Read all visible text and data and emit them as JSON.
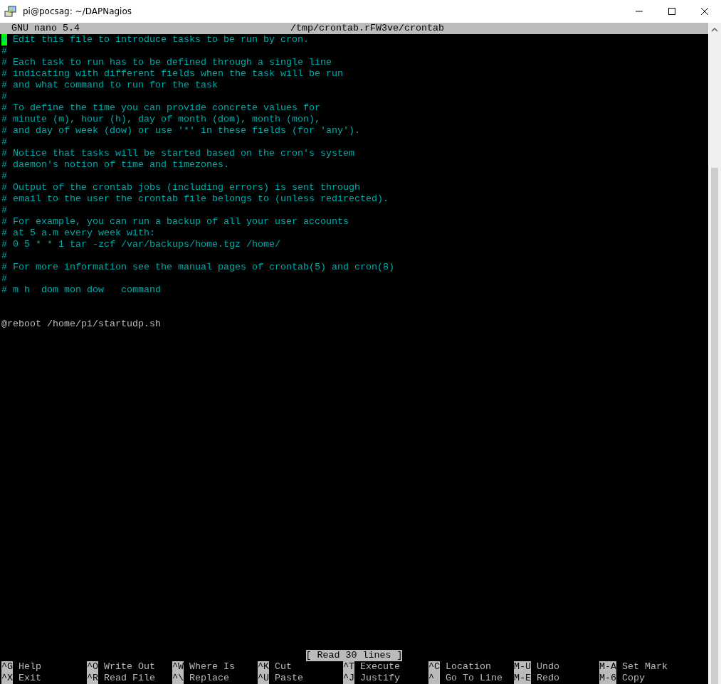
{
  "window": {
    "title": "pi@pocsag: ~/DAPNagios"
  },
  "header": {
    "program": "GNU nano 5.4",
    "file": "/tmp/crontab.rFW3ve/crontab"
  },
  "lines": [
    {
      "kind": "comment",
      "text": "# Edit this file to introduce tasks to be run by cron.",
      "cursor": true
    },
    {
      "kind": "comment",
      "text": "#",
      "cursor": false
    },
    {
      "kind": "comment",
      "text": "# Each task to run has to be defined through a single line",
      "cursor": false
    },
    {
      "kind": "comment",
      "text": "# indicating with different fields when the task will be run",
      "cursor": false
    },
    {
      "kind": "comment",
      "text": "# and what command to run for the task",
      "cursor": false
    },
    {
      "kind": "comment",
      "text": "#",
      "cursor": false
    },
    {
      "kind": "comment",
      "text": "# To define the time you can provide concrete values for",
      "cursor": false
    },
    {
      "kind": "comment",
      "text": "# minute (m), hour (h), day of month (dom), month (mon),",
      "cursor": false
    },
    {
      "kind": "comment",
      "text": "# and day of week (dow) or use '*' in these fields (for 'any').",
      "cursor": false
    },
    {
      "kind": "comment",
      "text": "#",
      "cursor": false
    },
    {
      "kind": "comment",
      "text": "# Notice that tasks will be started based on the cron's system",
      "cursor": false
    },
    {
      "kind": "comment",
      "text": "# daemon's notion of time and timezones.",
      "cursor": false
    },
    {
      "kind": "comment",
      "text": "#",
      "cursor": false
    },
    {
      "kind": "comment",
      "text": "# Output of the crontab jobs (including errors) is sent through",
      "cursor": false
    },
    {
      "kind": "comment",
      "text": "# email to the user the crontab file belongs to (unless redirected).",
      "cursor": false
    },
    {
      "kind": "comment",
      "text": "#",
      "cursor": false
    },
    {
      "kind": "comment",
      "text": "# For example, you can run a backup of all your user accounts",
      "cursor": false
    },
    {
      "kind": "comment",
      "text": "# at 5 a.m every week with:",
      "cursor": false
    },
    {
      "kind": "comment",
      "text": "# 0 5 * * 1 tar -zcf /var/backups/home.tgz /home/",
      "cursor": false
    },
    {
      "kind": "comment",
      "text": "#",
      "cursor": false
    },
    {
      "kind": "comment",
      "text": "# For more information see the manual pages of crontab(5) and cron(8)",
      "cursor": false
    },
    {
      "kind": "comment",
      "text": "#",
      "cursor": false
    },
    {
      "kind": "comment",
      "text": "# m h  dom mon dow   command",
      "cursor": false
    },
    {
      "kind": "blank"
    },
    {
      "kind": "blank"
    },
    {
      "kind": "command",
      "text": "@reboot /home/pi/startudp.sh",
      "cursor": false
    }
  ],
  "status": "[ Read 30 lines ]",
  "shortcuts": [
    [
      {
        "key": "^G",
        "label": "Help"
      },
      {
        "key": "^X",
        "label": "Exit"
      }
    ],
    [
      {
        "key": "^O",
        "label": "Write Out"
      },
      {
        "key": "^R",
        "label": "Read File"
      }
    ],
    [
      {
        "key": "^W",
        "label": "Where Is"
      },
      {
        "key": "^\\",
        "label": "Replace"
      }
    ],
    [
      {
        "key": "^K",
        "label": "Cut"
      },
      {
        "key": "^U",
        "label": "Paste"
      }
    ],
    [
      {
        "key": "^T",
        "label": "Execute"
      },
      {
        "key": "^J",
        "label": "Justify"
      }
    ],
    [
      {
        "key": "^C",
        "label": "Location"
      },
      {
        "key": "^",
        "label": "Go To Line"
      }
    ],
    [
      {
        "key": "M-U",
        "label": "Undo"
      },
      {
        "key": "M-E",
        "label": "Redo"
      }
    ],
    [
      {
        "key": "M-A",
        "label": "Set Mark"
      },
      {
        "key": "M-6",
        "label": "Copy"
      }
    ]
  ]
}
